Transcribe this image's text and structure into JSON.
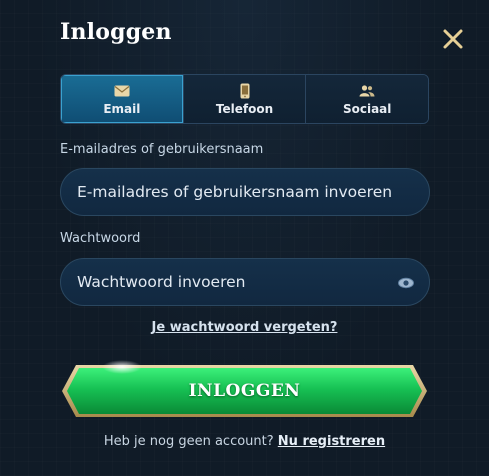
{
  "header": {
    "title": "Inloggen",
    "close_icon": "close-icon"
  },
  "tabs": [
    {
      "label": "Email",
      "icon": "envelope-icon",
      "active": true
    },
    {
      "label": "Telefoon",
      "icon": "phone-icon",
      "active": false
    },
    {
      "label": "Sociaal",
      "icon": "people-icon",
      "active": false
    }
  ],
  "form": {
    "username_label": "E-mailadres of gebruikersnaam",
    "username_placeholder": "E-mailadres of gebruikersnaam invoeren",
    "password_label": "Wachtwoord",
    "password_placeholder": "Wachtwoord invoeren",
    "forgot_link": "Je wachtwoord vergeten?",
    "submit_label": "INLOGGEN"
  },
  "footer": {
    "prompt": "Heb je nog geen account?",
    "register_link": "Nu registreren"
  },
  "colors": {
    "background": "#101b27",
    "accent_tab": "#1a6d95",
    "button_green": "#17c154",
    "button_gold": "#d8c38e"
  }
}
